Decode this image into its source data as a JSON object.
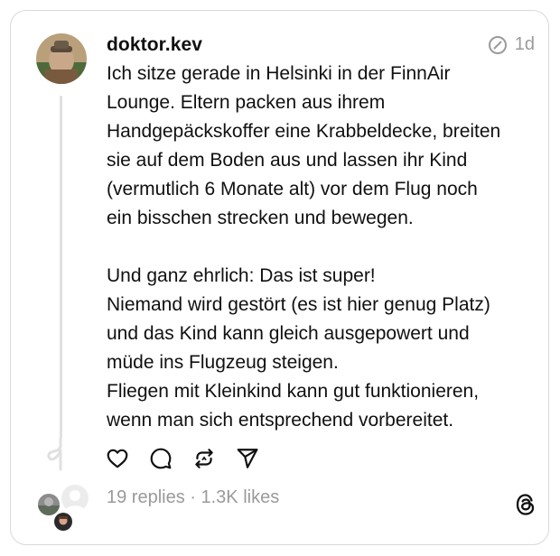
{
  "post": {
    "username": "doktor.kev",
    "time": "1d",
    "paragraphs": [
      [
        "Ich sitze gerade in Helsinki in der FinnAir",
        "Lounge. Eltern packen aus ihrem",
        "Handgepäckskoffer eine Krabbeldecke, breiten",
        "sie auf dem Boden aus und lassen ihr Kind",
        "(vermutlich 6 Monate alt) vor dem Flug noch",
        "ein bisschen strecken und bewegen."
      ],
      [
        "Und ganz ehrlich: Das ist super!",
        "Niemand wird gestört (es ist hier genug Platz)",
        "und das Kind kann gleich ausgepowert und",
        "müde ins Flugzeug steigen.",
        "Fliegen mit Kleinkind kann gut funktionieren,",
        "wenn man sich entsprechend vorbereitet."
      ]
    ]
  },
  "actions": {
    "like_icon": "heart-icon",
    "reply_icon": "comment-icon",
    "repost_icon": "repost-icon",
    "share_icon": "send-icon"
  },
  "stats": {
    "replies": "19 replies",
    "separator": " · ",
    "likes": "1.3K likes"
  },
  "colors": {
    "text": "#101010",
    "muted": "#9a9a9a",
    "border": "#d9d9d9",
    "thread_line": "#e0e0e0"
  }
}
